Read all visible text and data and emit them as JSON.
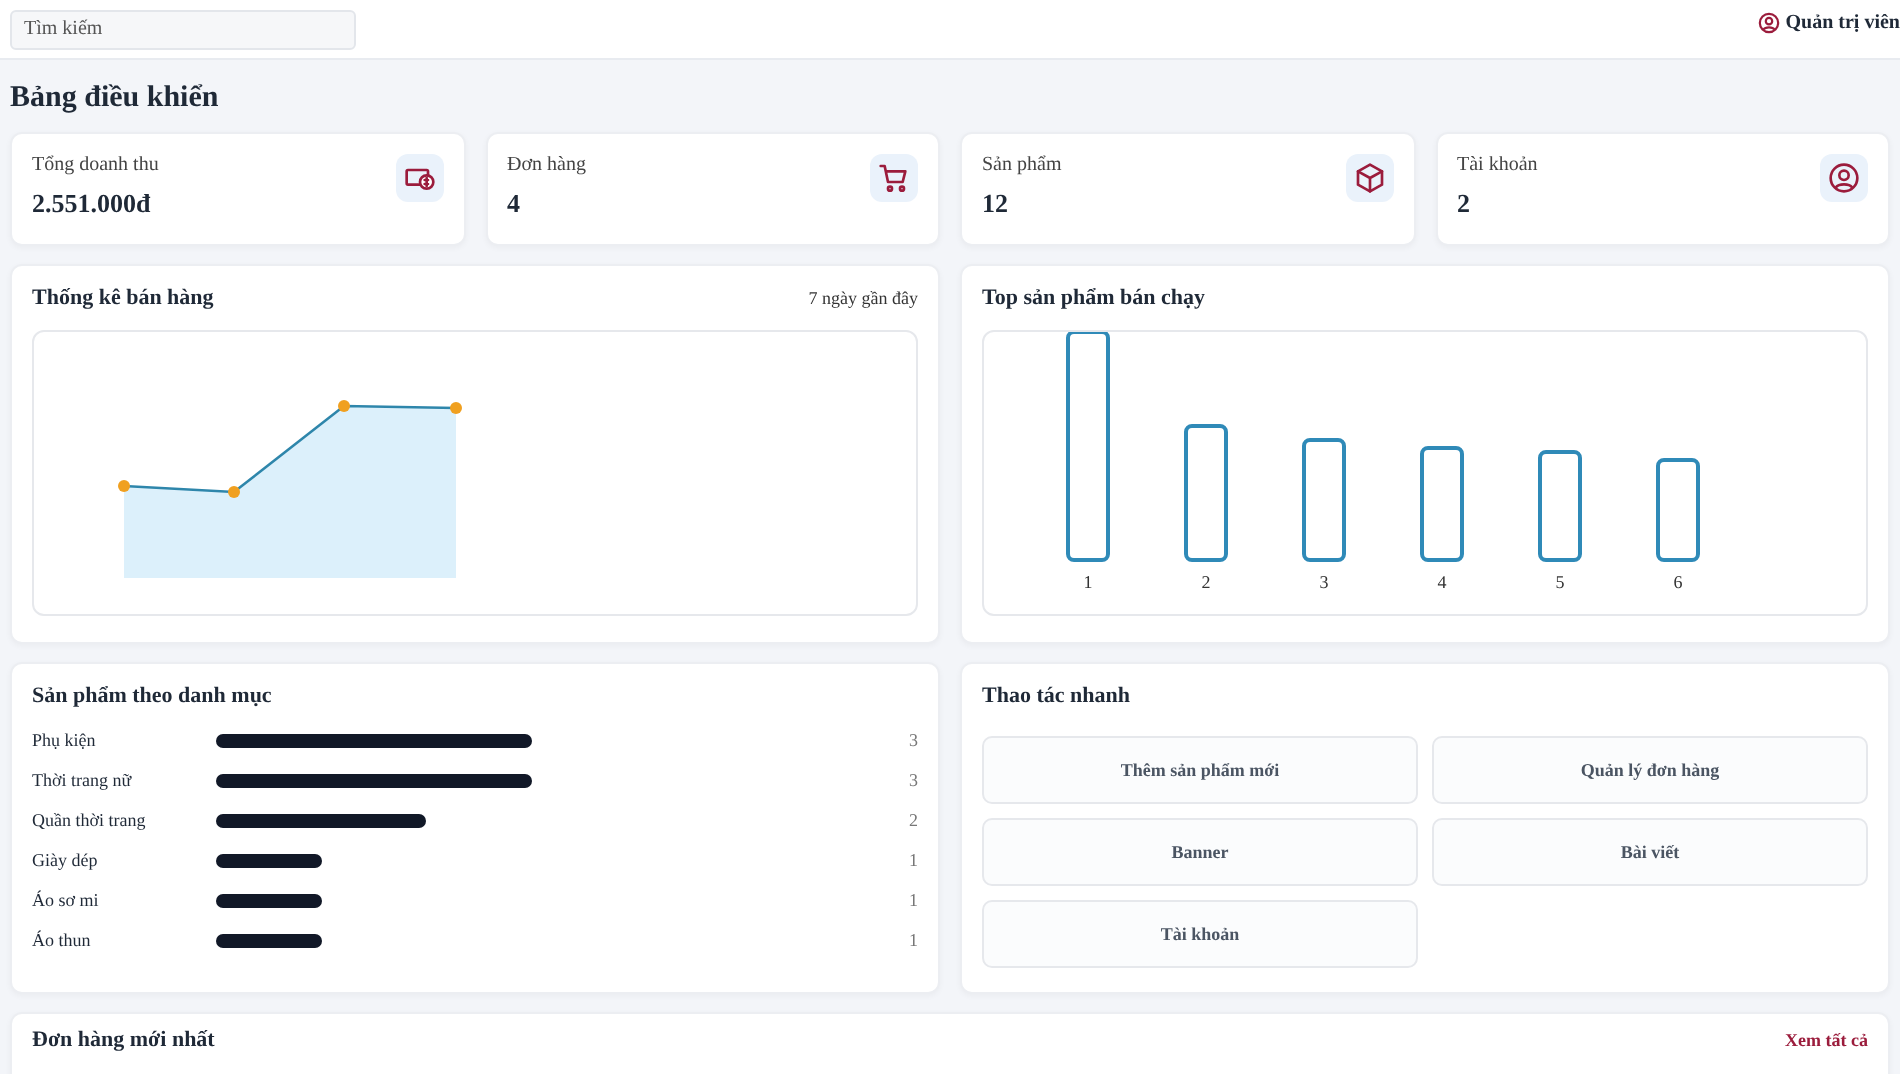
{
  "topbar": {
    "search": {
      "placeholder": "Tìm kiếm"
    },
    "user": {
      "label": "Quản trị viên"
    }
  },
  "page_title": "Bảng điều khiển",
  "stats": [
    {
      "kind": "money",
      "label": "Tổng doanh thu",
      "value": "2.551.000đ"
    },
    {
      "kind": "cart",
      "label": "Đơn hàng",
      "value": "4"
    },
    {
      "kind": "box",
      "label": "Sản phẩm",
      "value": "12"
    },
    {
      "kind": "user",
      "label": "Tài khoản",
      "value": "2"
    }
  ],
  "sales_panel": {
    "title": "Thống kê bán hàng",
    "range": "7 ngày gần đây"
  },
  "top_products_panel": {
    "title": "Top sản phẩm bán chạy",
    "labels": [
      "1",
      "2",
      "3",
      "4",
      "5",
      "6"
    ]
  },
  "category_panel": {
    "title": "Sản phẩm theo danh mục",
    "rows": [
      {
        "name": "Phụ kiện",
        "count": "3"
      },
      {
        "name": "Thời trang nữ",
        "count": "3"
      },
      {
        "name": "Quần thời trang",
        "count": "2"
      },
      {
        "name": "Giày dép",
        "count": "1"
      },
      {
        "name": "Áo sơ mi",
        "count": "1"
      },
      {
        "name": "Áo thun",
        "count": "1"
      }
    ]
  },
  "quick_actions": {
    "title": "Thao tác nhanh",
    "buttons": [
      "Thêm sản phẩm mới",
      "Quản lý đơn hàng",
      "Banner",
      "Bài viết",
      "Tài khoản"
    ]
  },
  "orders_panel": {
    "title": "Đơn hàng mới nhất",
    "link": "Xem tất cả"
  }
}
